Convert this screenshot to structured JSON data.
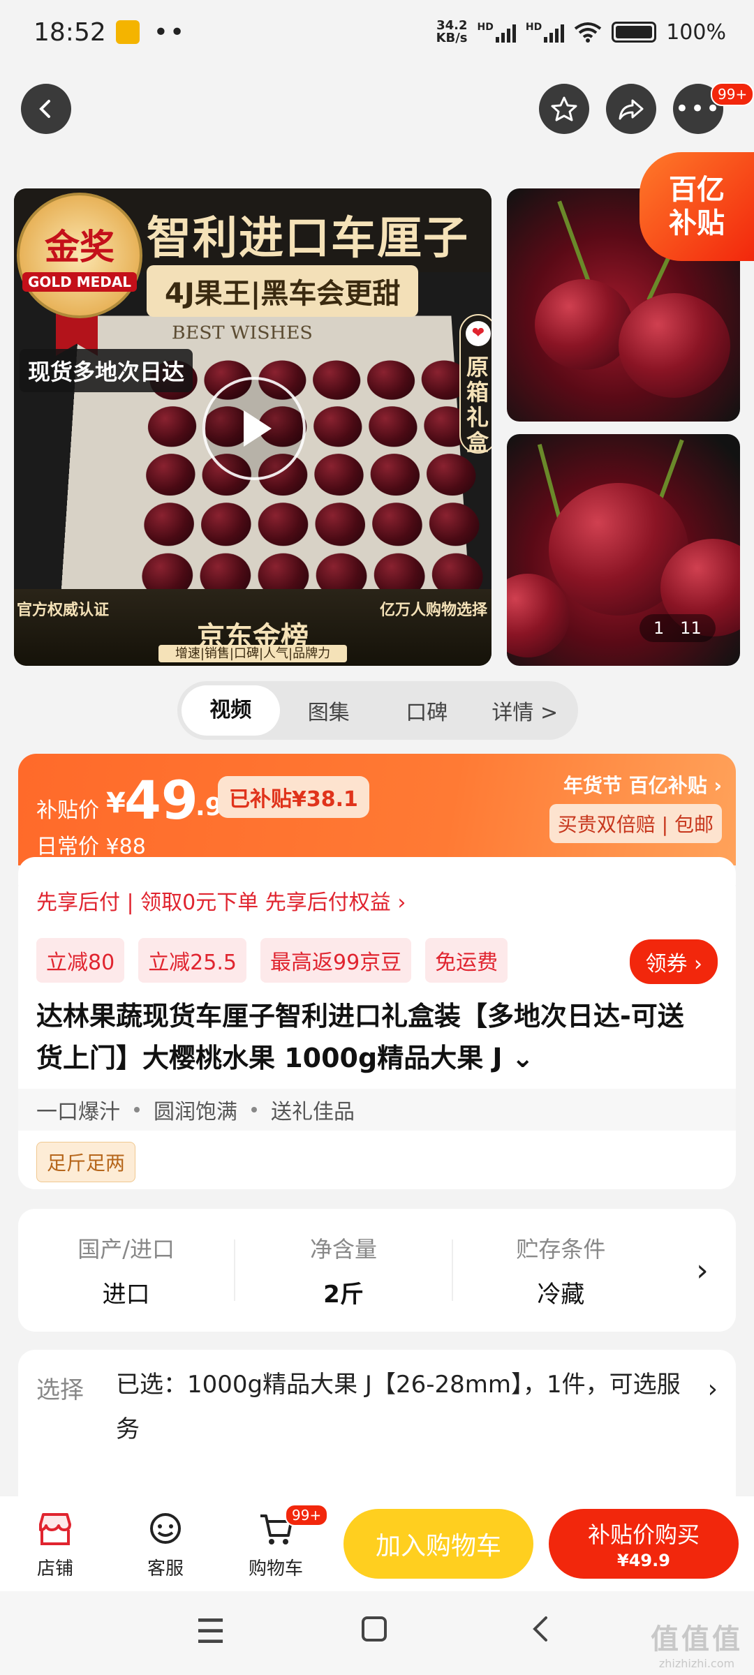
{
  "status_bar": {
    "time": "18:52",
    "net_speed_value": "34.2",
    "net_speed_unit": "KB/s",
    "signal_1_tag": "HD",
    "signal_2_tag": "HD",
    "battery": "100%"
  },
  "nav": {
    "more_badge": "99+"
  },
  "gallery": {
    "main_title": "智利进口车厘子",
    "main_subtitle": "4J果王|黑车会更甜",
    "medal_cn": "金奖",
    "medal_en": "GOLD MEDAL",
    "box_text": "BEST WISHES",
    "shipping_tag": "现货多地次日达",
    "gift_box": "原箱礼盒",
    "footer_left": "官方权威认证",
    "footer_right": "亿万人购物选择",
    "footer_brand": "京东金榜",
    "footer_tags": "增速|销售|口碑|人气|品牌力",
    "subsidy_corner_line1": "百亿",
    "subsidy_corner_line2": "补贴",
    "counter_current": "1",
    "counter_total": "11"
  },
  "tabs": [
    {
      "label": "视频"
    },
    {
      "label": "图集"
    },
    {
      "label": "口碑"
    },
    {
      "label": "详情 >"
    }
  ],
  "price": {
    "label": "补贴价",
    "currency": "¥",
    "integer": "49",
    "decimal": ".9",
    "subsidized": "已补贴¥38.1",
    "daily_price": "日常价 ¥88",
    "event": "年货节 百亿补贴",
    "guarantee": "买贵双倍赔 | 包邮"
  },
  "info": {
    "afterpay": "先享后付 | 领取0元下单 先享后付权益 ›",
    "coupons": [
      "立减80",
      "立减25.5",
      "最高返99京豆",
      "免运费"
    ],
    "get_coupon": "领券 ›",
    "title": "达林果蔬现货车厘子智利进口礼盒装【多地次日达-可送货上门】大樱桃水果 1000g精品大果 J ⌄",
    "features": [
      "一口爆汁",
      "圆润饱满",
      "送礼佳品"
    ],
    "weight_tag": "足斤足两"
  },
  "specs": [
    {
      "key": "国产/进口",
      "value": "进口"
    },
    {
      "key": "净含量",
      "value": "2斤"
    },
    {
      "key": "贮存条件",
      "value": "冷藏"
    }
  ],
  "selection": {
    "label": "选择",
    "value": "已选：1000g精品大果 J【26-28mm】，1件，可选服务"
  },
  "action_bar": {
    "store": "店铺",
    "service": "客服",
    "cart": "购物车",
    "cart_badge": "99+",
    "add_to_cart": "加入购物车",
    "buy_label": "补贴价购买",
    "buy_price": "¥49.9"
  },
  "watermark": {
    "main": "值值值",
    "sub": "zhizhizhi.com"
  },
  "colors": {
    "accent_red": "#f2270c",
    "accent_orange": "#ff6a2a",
    "cart_yellow": "#ffcf1f"
  }
}
